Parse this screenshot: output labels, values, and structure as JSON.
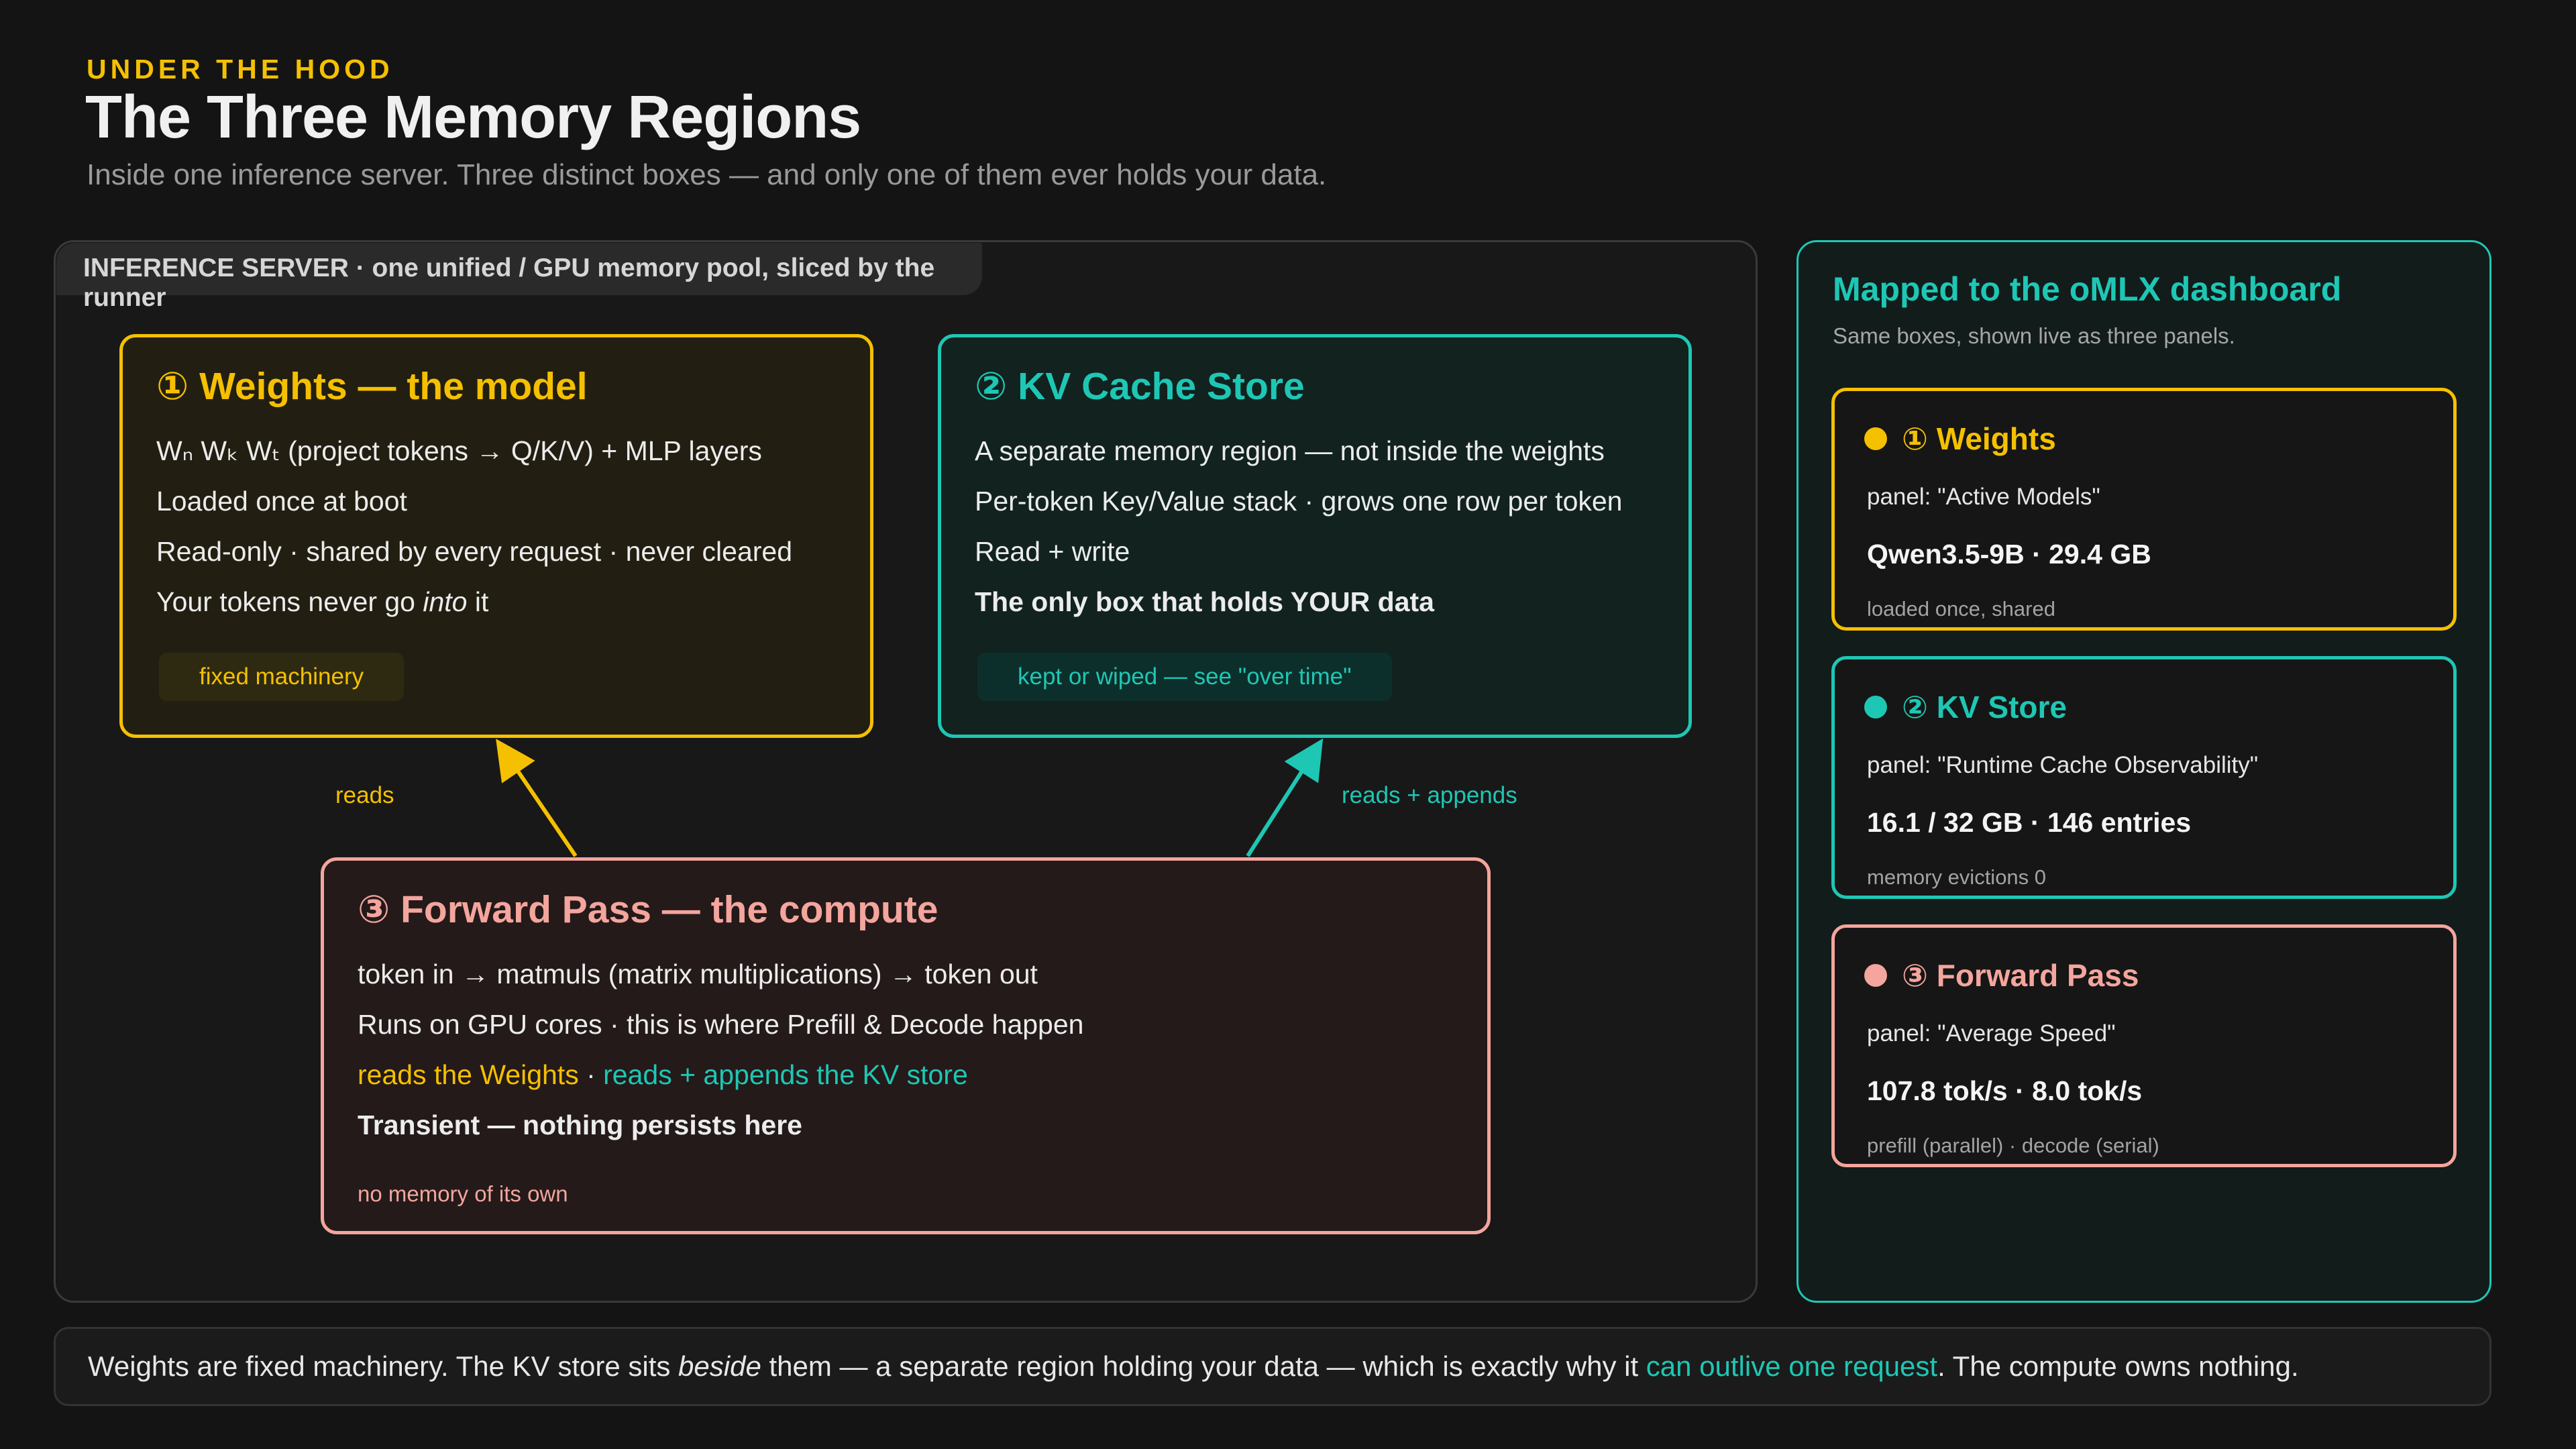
{
  "header": {
    "eyebrow": "UNDER THE HOOD",
    "title": "The Three Memory Regions",
    "subtitle": "Inside one inference server. Three distinct boxes — and only one of them ever holds your data."
  },
  "server": {
    "label": "INFERENCE SERVER · one unified / GPU memory pool, sliced by the runner",
    "weights": {
      "title": "① Weights — the model",
      "lines": [
        "Wₙ Wₖ Wₜ (project tokens → Q/K/V) + MLP layers",
        "Loaded once at boot",
        "Read-only · shared by every request · never cleared"
      ],
      "line4_pre": "Your tokens never go ",
      "line4_em": "into",
      "line4_post": " it",
      "chip": "fixed machinery"
    },
    "kv": {
      "title": "② KV Cache Store",
      "lines": [
        "A separate memory region — not inside the weights",
        "Per-token Key/Value stack · grows one row per token",
        "Read + write"
      ],
      "bold_line": "The only box that holds YOUR data",
      "chip": "kept or wiped — see \"over time\""
    },
    "forward": {
      "title": "③ Forward Pass — the compute",
      "lines": [
        "token in → matmuls (matrix multiplications) → token out",
        "Runs on GPU cores · this is where Prefill & Decode happen"
      ],
      "reads_weights": "reads the Weights",
      "separator": " · ",
      "reads_kv": "reads + appends the KV store",
      "bold_line": "Transient — nothing persists here",
      "note": "no memory of its own"
    },
    "arrows": {
      "left_label": "reads",
      "right_label": "reads + appends"
    }
  },
  "dashboard": {
    "title": "Mapped to the oMLX dashboard",
    "subtitle": "Same boxes, shown live as three panels.",
    "cards": [
      {
        "title": "① Weights",
        "panel": "panel: \"Active Models\"",
        "metric": "Qwen3.5-9B · 29.4 GB",
        "foot": "loaded once, shared"
      },
      {
        "title": "② KV Store",
        "panel": "panel: \"Runtime Cache Observability\"",
        "metric": "16.1 / 32 GB · 146 entries",
        "foot": "memory evictions 0"
      },
      {
        "title": "③ Forward Pass",
        "panel": "panel: \"Average Speed\"",
        "metric": "107.8 tok/s · 8.0 tok/s",
        "foot": "prefill (parallel) · decode (serial)"
      }
    ]
  },
  "footer": {
    "part1": "Weights are fixed machinery. The KV store sits ",
    "em": "beside",
    "part2": " them — a separate region holding your data — which is exactly why it ",
    "highlight": "can outlive one request",
    "part3": ". The compute owns nothing."
  },
  "colors": {
    "weights": "#f5c000",
    "kv": "#1ec7b4",
    "forward": "#f4a59d",
    "background": "#141414"
  }
}
